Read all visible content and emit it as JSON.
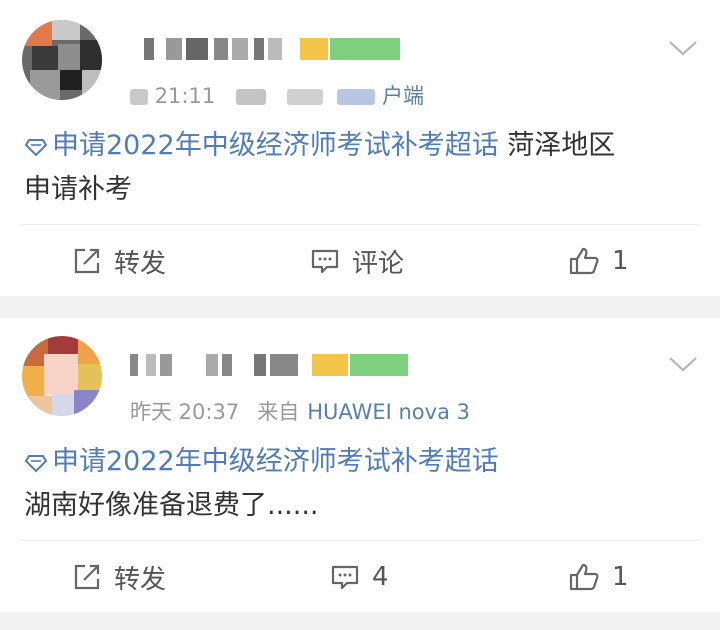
{
  "posts": [
    {
      "time": "21:11",
      "device": "户端",
      "topic": "申请2022年中级经济师考试补考超话",
      "text_line1": " 菏泽地区",
      "text_line2": "申请补考",
      "actions": {
        "repost": "转发",
        "comment": "评论",
        "like_count": "1"
      }
    },
    {
      "time": "昨天 20:37",
      "from_label": "来自",
      "device": "HUAWEI nova 3",
      "topic": "申请2022年中级经济师考试补考超话",
      "text_line1": "",
      "text_line2": "湖南好像准备退费了......",
      "actions": {
        "repost": "转发",
        "comment": "4",
        "like_count": "1"
      }
    }
  ],
  "colors": {
    "link": "#4f7dbb",
    "meta": "#999999",
    "device": "#5a7fab",
    "separator": "#f2f2f2"
  },
  "icons": [
    "avatar-image",
    "chevron-down-icon",
    "topic-diamond-icon",
    "repost-icon",
    "comment-icon",
    "like-icon"
  ]
}
